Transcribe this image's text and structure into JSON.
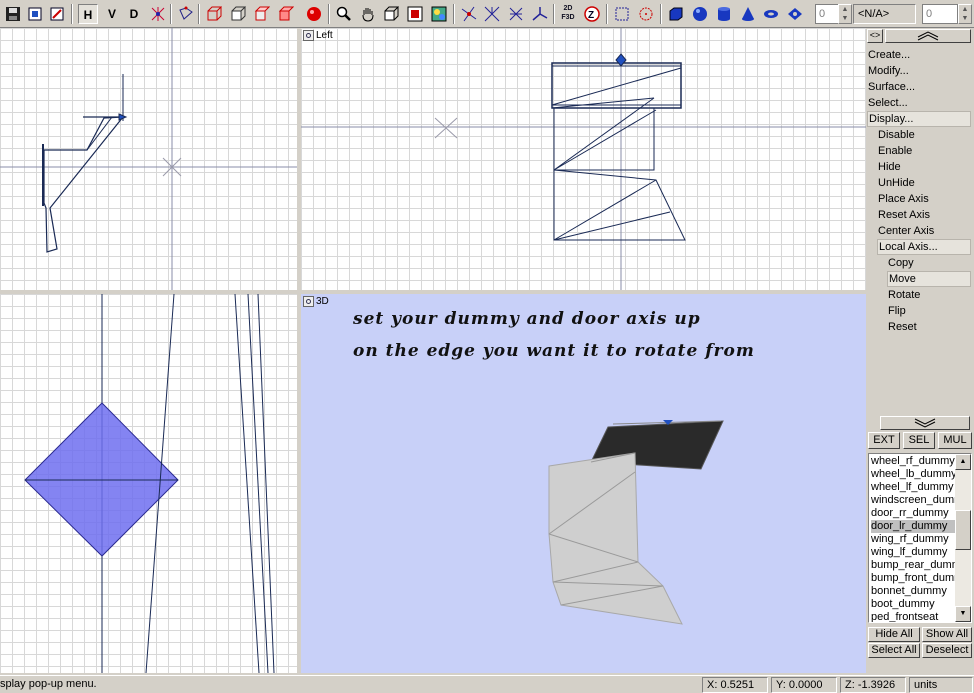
{
  "toolbar": {
    "mode_h": "H",
    "mode_v": "V",
    "mode_d": "D",
    "mode_2d3d": "2D F3D",
    "spin_left_value": "0",
    "dropdown_value": "<N/A>",
    "spin_right_value": "0"
  },
  "viewports": {
    "left_label": "Left",
    "view3d_label": "3D",
    "overlay_line1": "set your dummy and door axis up",
    "overlay_line2": "on the edge you want it to rotate from"
  },
  "panel": {
    "menu": [
      "Create...",
      "Modify...",
      "Surface...",
      "Select...",
      "Display..."
    ],
    "display_items": [
      "Disable",
      "Enable",
      "Hide",
      "UnHide",
      "Place Axis",
      "Reset Axis",
      "Center Axis",
      "Local Axis..."
    ],
    "local_axis_items": [
      "Copy",
      "Move",
      "Rotate",
      "Flip",
      "Reset"
    ],
    "filter_buttons": [
      "EXT",
      "SEL",
      "MUL"
    ],
    "objects": [
      "wheel_rf_dummy",
      "wheel_lb_dummy",
      "wheel_lf_dummy",
      "windscreen_dummy",
      "door_rr_dummy",
      "door_lr_dummy",
      "wing_rf_dummy",
      "wing_lf_dummy",
      "bump_rear_dummy",
      "bump_front_dummy",
      "bonnet_dummy",
      "boot_dummy",
      "ped_frontseat"
    ],
    "selected_object": "door_lr_dummy",
    "hide_all": "Hide All",
    "show_all": "Show All",
    "select_all": "Select All",
    "deselect": "Deselect"
  },
  "status": {
    "message": "splay pop-up menu.",
    "x": "X: 0.5251",
    "y": "Y: 0.0000",
    "z": "Z: -1.3926",
    "units": "units"
  },
  "colors": {
    "wire": "#1a2a55",
    "selection_fill": "#6f6ff0",
    "background_3d": "#c8d0f8"
  }
}
